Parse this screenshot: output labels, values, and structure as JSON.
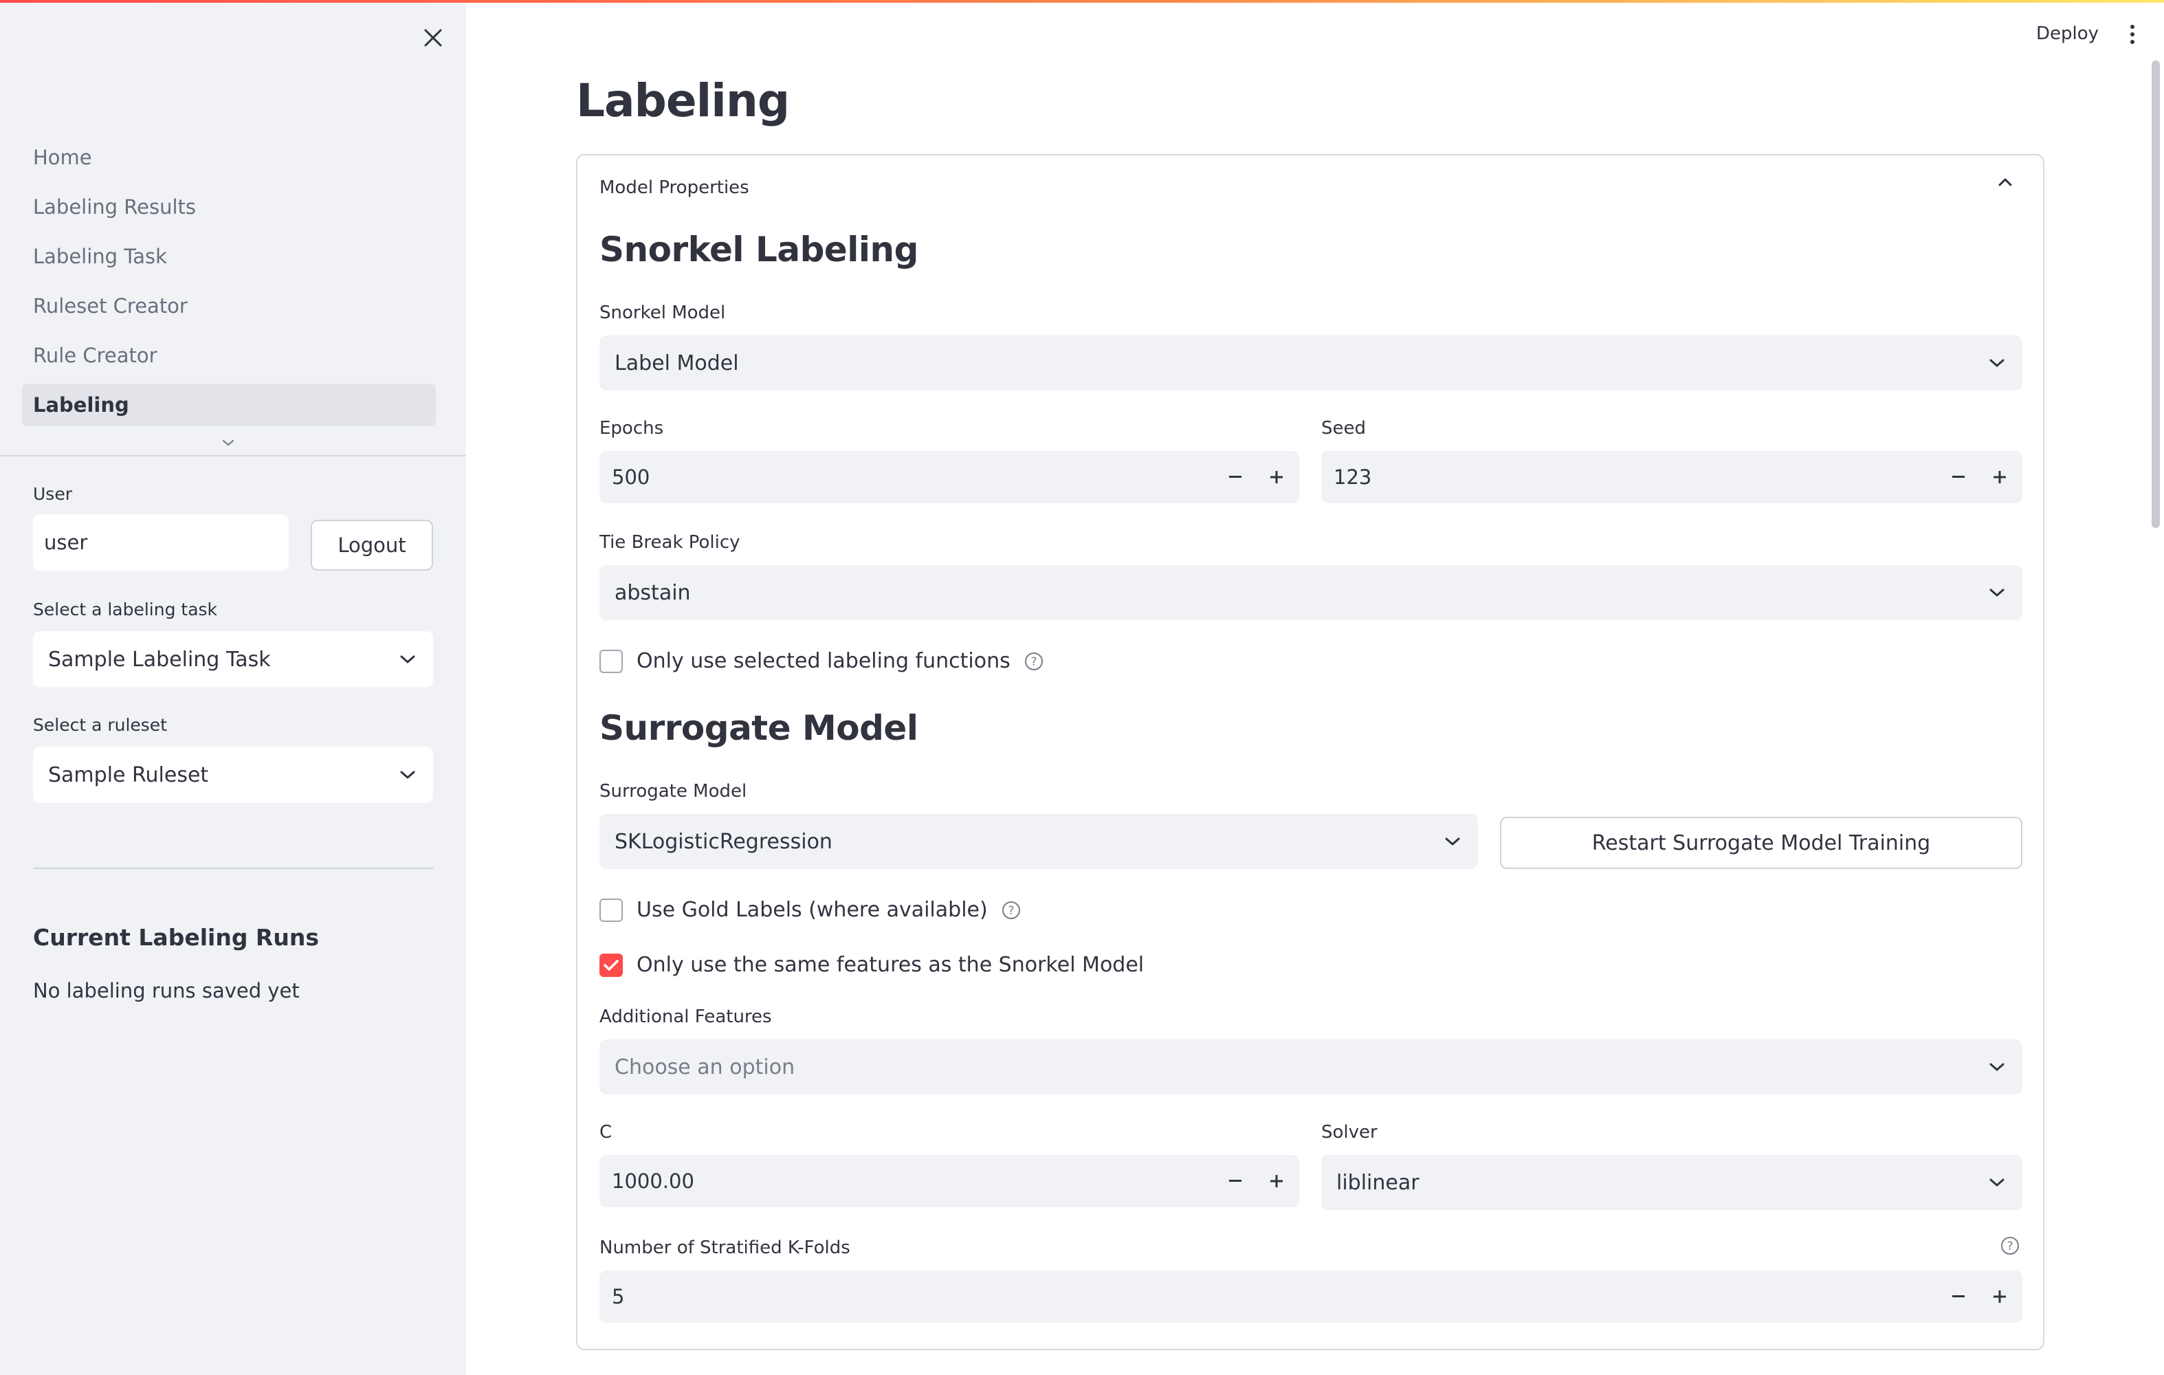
{
  "sidebar": {
    "nav": [
      {
        "label": "Home",
        "active": false
      },
      {
        "label": "Labeling Results",
        "active": false
      },
      {
        "label": "Labeling Task",
        "active": false
      },
      {
        "label": "Ruleset Creator",
        "active": false
      },
      {
        "label": "Rule Creator",
        "active": false
      },
      {
        "label": "Labeling",
        "active": true
      }
    ],
    "user_label": "User",
    "user_value": "user",
    "logout_label": "Logout",
    "task_label": "Select a labeling task",
    "task_value": "Sample Labeling Task",
    "ruleset_label": "Select a ruleset",
    "ruleset_value": "Sample Ruleset",
    "runs_title": "Current Labeling Runs",
    "runs_empty": "No labeling runs saved yet"
  },
  "header": {
    "deploy_label": "Deploy"
  },
  "page": {
    "title": "Labeling"
  },
  "expander": {
    "label": "Model Properties",
    "snorkel": {
      "heading": "Snorkel Labeling",
      "model_label": "Snorkel Model",
      "model_value": "Label Model",
      "epochs_label": "Epochs",
      "epochs_value": "500",
      "seed_label": "Seed",
      "seed_value": "123",
      "tiebreak_label": "Tie Break Policy",
      "tiebreak_value": "abstain",
      "only_selected_label": "Only use selected labeling functions",
      "only_selected_checked": false
    },
    "surrogate": {
      "heading": "Surrogate Model",
      "model_label": "Surrogate Model",
      "model_value": "SKLogisticRegression",
      "restart_label": "Restart Surrogate Model Training",
      "gold_label": "Use Gold Labels (where available)",
      "gold_checked": false,
      "same_features_label": "Only use the same features as the Snorkel Model",
      "same_features_checked": true,
      "additional_label": "Additional Features",
      "additional_placeholder": "Choose an option",
      "c_label": "C",
      "c_value": "1000.00",
      "solver_label": "Solver",
      "solver_value": "liblinear",
      "kfolds_label": "Number of Stratified K-Folds",
      "kfolds_value": "5"
    }
  },
  "colors": {
    "accent": "#ff4b4b",
    "sidebar_bg": "#f0f2f6",
    "text": "#31333f",
    "muted_text": "#6b6e7b",
    "input_bg": "#f0f2f6"
  },
  "icons": {
    "close": "close-icon",
    "chevron_up": "chevron-up-icon",
    "chevron_down": "chevron-down-icon",
    "help": "help-circle-icon",
    "menu": "kebab-menu-icon"
  }
}
